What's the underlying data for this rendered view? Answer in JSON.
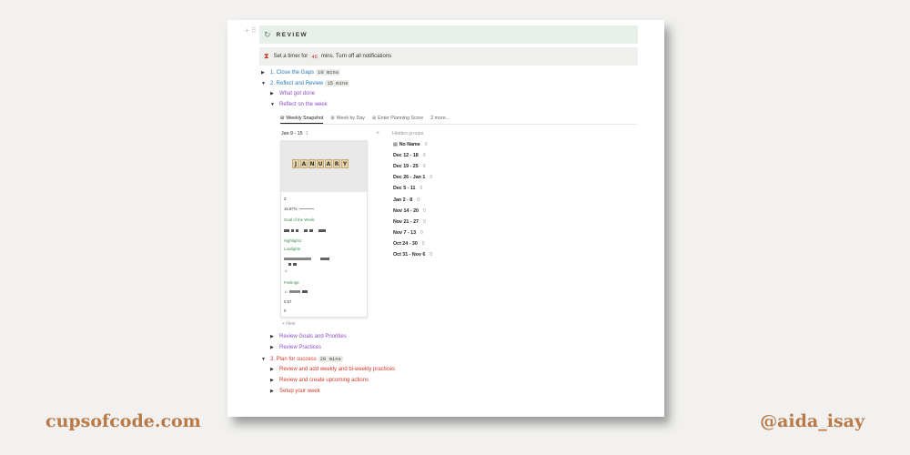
{
  "brand": {
    "site": "cupsofcode.com",
    "handle": "@aida_isay"
  },
  "review_banner": {
    "icon": "refresh-icon",
    "label": "REVIEW"
  },
  "timer": {
    "icon": "hourglass-icon",
    "prefix": "Set a timer for",
    "minutes": "45",
    "suffix": "mins. Turn off all notifications"
  },
  "sections": [
    {
      "label": "1. Close the Gaps",
      "duration": "10 mins",
      "color": "#2b7ab4",
      "expanded": false
    },
    {
      "label": "2. Reflect and Review",
      "duration": "15 mins",
      "color": "#2b7ab4",
      "expanded": true,
      "children": [
        {
          "label": "What got done",
          "expanded": false
        },
        {
          "label": "Reflect on the week",
          "expanded": true
        },
        {
          "label": "Review Goals and Priorities",
          "expanded": false
        },
        {
          "label": "Review  Practices",
          "expanded": false
        }
      ]
    },
    {
      "label": "3. Plan for success",
      "duration": "20 mins",
      "color": "#d6372b",
      "expanded": true,
      "children": [
        {
          "label": "Review and add weekly and bi-weekly practices"
        },
        {
          "label": "Review and create upcoming actions"
        },
        {
          "label": "Setup your week"
        }
      ]
    }
  ],
  "view_tabs": [
    {
      "label": "Weekly Snapshot",
      "icon": "table-icon",
      "active": true
    },
    {
      "label": "Week by Day",
      "icon": "table-icon",
      "active": false
    },
    {
      "label": "Enter Planning Score",
      "icon": "table-icon",
      "active": false
    },
    {
      "label": "2 more...",
      "icon": "",
      "active": false
    }
  ],
  "board": {
    "group_title": "Jan 9 - 15",
    "group_count": "1",
    "add_symbol": "+",
    "hidden_groups_label": "Hidden groups",
    "new_label": "+ New",
    "card": {
      "cover_word": "JANUARY",
      "value_a": "2",
      "percent": "16.67%",
      "goal_label": "Goal of the Week:",
      "highlights_label": "Highlights:",
      "lowlights_label": "Lowlights:",
      "feelings_label": "Feelings:",
      "value_b": "0.57",
      "value_c": "0"
    },
    "hidden_groups": [
      {
        "label": "No Name",
        "count": "0",
        "icon": "doc-icon"
      },
      {
        "label": "Dec 12 - 18",
        "count": "0"
      },
      {
        "label": "Dec 19 - 25",
        "count": "0"
      },
      {
        "label": "Dec 26 - Jan 1",
        "count": "0"
      },
      {
        "label": "Dec 5 - 11",
        "count": "0"
      },
      {
        "label": "Jan 2 - 8",
        "count": "0"
      },
      {
        "label": "Nov 14 - 20",
        "count": "0"
      },
      {
        "label": "Nov 21 - 27",
        "count": "0"
      },
      {
        "label": "Nov 7 - 13",
        "count": "0"
      },
      {
        "label": "Oct 24 - 30",
        "count": "0"
      },
      {
        "label": "Oct 31 - Nov 6",
        "count": "0"
      }
    ]
  }
}
